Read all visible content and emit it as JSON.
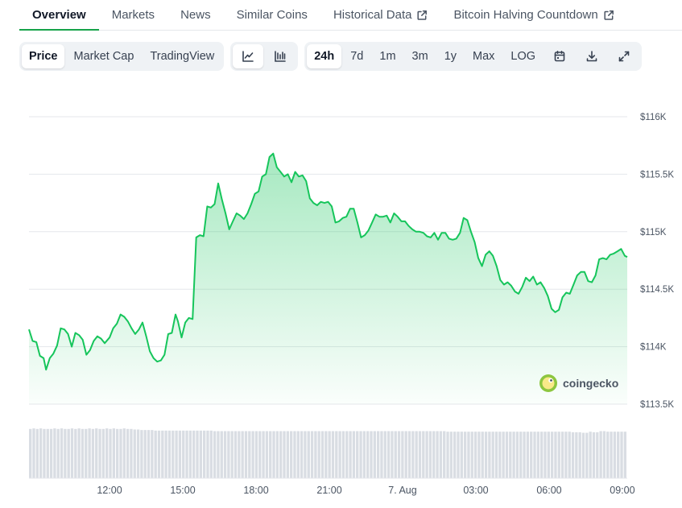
{
  "tabs": [
    {
      "label": "Overview",
      "active": true,
      "external": false
    },
    {
      "label": "Markets",
      "active": false,
      "external": false
    },
    {
      "label": "News",
      "active": false,
      "external": false
    },
    {
      "label": "Similar Coins",
      "active": false,
      "external": false
    },
    {
      "label": "Historical Data",
      "active": false,
      "external": true
    },
    {
      "label": "Bitcoin Halving Countdown",
      "active": false,
      "external": true
    }
  ],
  "toolbar": {
    "views": [
      "Price",
      "Market Cap",
      "TradingView"
    ],
    "active_view": "Price",
    "chart_types": [
      {
        "name": "line-chart-icon",
        "active": true
      },
      {
        "name": "candlestick-chart-icon",
        "active": false
      }
    ],
    "ranges": [
      "24h",
      "7d",
      "1m",
      "3m",
      "1y",
      "Max",
      "LOG"
    ],
    "active_range": "24h",
    "icons": [
      "calendar-icon",
      "download-icon",
      "fullscreen-icon"
    ]
  },
  "watermark": "coingecko",
  "colors": {
    "accent": "#16a34a",
    "line": "#16c55b",
    "fill_top": "#16c55b",
    "grid": "#e5e7eb",
    "volume": "#d9dde3"
  },
  "chart_data": {
    "type": "area",
    "title": "",
    "xlabel": "",
    "ylabel": "",
    "ylim": [
      113500,
      116000
    ],
    "y_ticks": [
      113500,
      114000,
      114500,
      115000,
      115500,
      116000
    ],
    "y_tick_labels": [
      "$113.5K",
      "$114K",
      "$114.5K",
      "$115K",
      "$115.5K",
      "$116K"
    ],
    "x_tick_labels": [
      "12:00",
      "15:00",
      "18:00",
      "21:00",
      "7. Aug",
      "03:00",
      "06:00",
      "09:00"
    ],
    "x_tick_hours": [
      3,
      6,
      9,
      12,
      15,
      18,
      21,
      24
    ],
    "x_range_hours": [
      -0.3,
      24.2
    ],
    "grid": true,
    "series": [
      {
        "x_hours": [
          -0.3,
          -0.15,
          0,
          0.15,
          0.3,
          0.4,
          0.55,
          0.7,
          0.85,
          1.0,
          1.15,
          1.3,
          1.45,
          1.6,
          1.75,
          1.9,
          2.05,
          2.2,
          2.35,
          2.5,
          2.65,
          2.8,
          3.0,
          3.15,
          3.3,
          3.45,
          3.6,
          3.75,
          3.9,
          4.05,
          4.2,
          4.35,
          4.5,
          4.65,
          4.8,
          4.95,
          5.1,
          5.25,
          5.4,
          5.55,
          5.7,
          5.8,
          5.95,
          6.1,
          6.25,
          6.4,
          6.55,
          6.7,
          6.85,
          7.0,
          7.15,
          7.3,
          7.45,
          7.6,
          7.75,
          7.9,
          8.05,
          8.2,
          8.35,
          8.5,
          8.65,
          8.8,
          8.95,
          9.1,
          9.25,
          9.4,
          9.55,
          9.7,
          9.85,
          10.0,
          10.15,
          10.3,
          10.45,
          10.6,
          10.75,
          10.9,
          11.05,
          11.2,
          11.35,
          11.5,
          11.65,
          11.8,
          11.95,
          12.1,
          12.25,
          12.4,
          12.55,
          12.7,
          12.85,
          13.0,
          13.15,
          13.3,
          13.45,
          13.6,
          13.75,
          13.9,
          14.05,
          14.2,
          14.35,
          14.5,
          14.65,
          14.8,
          14.95,
          15.1,
          15.25,
          15.4,
          15.55,
          15.7,
          15.85,
          16.0,
          16.15,
          16.3,
          16.45,
          16.6,
          16.75,
          16.9,
          17.05,
          17.2,
          17.35,
          17.5,
          17.65,
          17.8,
          17.95,
          18.1,
          18.25,
          18.4,
          18.55,
          18.7,
          18.85,
          19.0,
          19.15,
          19.3,
          19.45,
          19.6,
          19.75,
          19.9,
          20.05,
          20.2,
          20.35,
          20.5,
          20.65,
          20.8,
          20.95,
          21.1,
          21.25,
          21.4,
          21.55,
          21.7,
          21.85,
          22.0,
          22.15,
          22.3,
          22.45,
          22.6,
          22.75,
          22.9,
          23.05,
          23.2,
          23.35,
          23.5,
          23.65,
          23.8,
          23.95,
          24.1,
          24.2
        ],
        "values": [
          114150,
          114050,
          114040,
          113920,
          113900,
          113800,
          113900,
          113940,
          114010,
          114160,
          114150,
          114110,
          114000,
          114120,
          114100,
          114060,
          113930,
          113970,
          114050,
          114090,
          114070,
          114030,
          114080,
          114160,
          114200,
          114280,
          114260,
          114220,
          114160,
          114110,
          114150,
          114210,
          114090,
          113960,
          113900,
          113870,
          113880,
          113930,
          114110,
          114120,
          114280,
          114220,
          114080,
          114210,
          114250,
          114240,
          114950,
          114970,
          114960,
          115220,
          115210,
          115240,
          115420,
          115280,
          115160,
          115020,
          115090,
          115160,
          115140,
          115110,
          115160,
          115240,
          115330,
          115350,
          115480,
          115500,
          115650,
          115680,
          115560,
          115520,
          115480,
          115500,
          115430,
          115520,
          115480,
          115490,
          115440,
          115290,
          115250,
          115230,
          115260,
          115250,
          115260,
          115220,
          115080,
          115090,
          115120,
          115130,
          115200,
          115200,
          115080,
          114950,
          114970,
          115010,
          115080,
          115150,
          115130,
          115130,
          115140,
          115080,
          115160,
          115130,
          115090,
          115090,
          115050,
          115020,
          115000,
          115000,
          114990,
          114960,
          114950,
          114990,
          114930,
          114990,
          114990,
          114940,
          114930,
          114940,
          114990,
          115120,
          115100,
          115000,
          114910,
          114770,
          114700,
          114800,
          114830,
          114790,
          114700,
          114580,
          114540,
          114560,
          114530,
          114480,
          114460,
          114520,
          114600,
          114570,
          114610,
          114540,
          114560,
          114510,
          114440,
          114330,
          114300,
          114320,
          114430,
          114470,
          114460,
          114540,
          114620,
          114650,
          114650,
          114570,
          114560,
          114620,
          114760,
          114770,
          114760,
          114800,
          114810,
          114830,
          114850,
          114790,
          114780,
          114760,
          114800,
          114920,
          114940
        ]
      }
    ],
    "volume_relative": [
      0.9,
      0.91,
      0.9,
      0.91,
      0.9,
      0.9,
      0.9,
      0.91,
      0.9,
      0.91,
      0.9,
      0.9,
      0.91,
      0.9,
      0.91,
      0.9,
      0.9,
      0.91,
      0.9,
      0.91,
      0.9,
      0.9,
      0.91,
      0.9,
      0.91,
      0.9,
      0.9,
      0.91,
      0.9,
      0.9,
      0.89,
      0.89,
      0.88,
      0.88,
      0.88,
      0.88,
      0.87,
      0.87,
      0.87,
      0.87,
      0.87,
      0.87,
      0.87,
      0.87,
      0.87,
      0.87,
      0.87,
      0.87,
      0.87,
      0.87,
      0.87,
      0.87,
      0.87,
      0.86,
      0.86,
      0.86,
      0.86,
      0.86,
      0.86,
      0.86,
      0.86,
      0.86,
      0.86,
      0.86,
      0.86,
      0.86,
      0.86,
      0.86,
      0.86,
      0.86,
      0.86,
      0.86,
      0.86,
      0.86,
      0.86,
      0.86,
      0.86,
      0.86,
      0.86,
      0.86,
      0.86,
      0.86,
      0.86,
      0.86,
      0.86,
      0.86,
      0.86,
      0.86,
      0.86,
      0.86,
      0.86,
      0.86,
      0.86,
      0.86,
      0.86,
      0.86,
      0.86,
      0.86,
      0.86,
      0.86,
      0.86,
      0.86,
      0.86,
      0.86,
      0.86,
      0.86,
      0.86,
      0.86,
      0.86,
      0.86,
      0.86,
      0.86,
      0.86,
      0.86,
      0.86,
      0.86,
      0.86,
      0.86,
      0.86,
      0.86,
      0.85,
      0.85,
      0.85,
      0.85,
      0.85,
      0.85,
      0.85,
      0.85,
      0.85,
      0.85,
      0.85,
      0.85,
      0.85,
      0.85,
      0.85,
      0.85,
      0.85,
      0.85,
      0.85,
      0.85,
      0.85,
      0.85,
      0.85,
      0.85,
      0.85,
      0.85,
      0.85,
      0.85,
      0.85,
      0.85,
      0.85,
      0.85,
      0.85,
      0.85,
      0.85,
      0.85,
      0.84,
      0.84,
      0.84,
      0.83,
      0.83,
      0.85,
      0.84,
      0.84,
      0.86,
      0.86,
      0.85,
      0.85,
      0.85,
      0.85,
      0.85,
      0.85
    ]
  }
}
